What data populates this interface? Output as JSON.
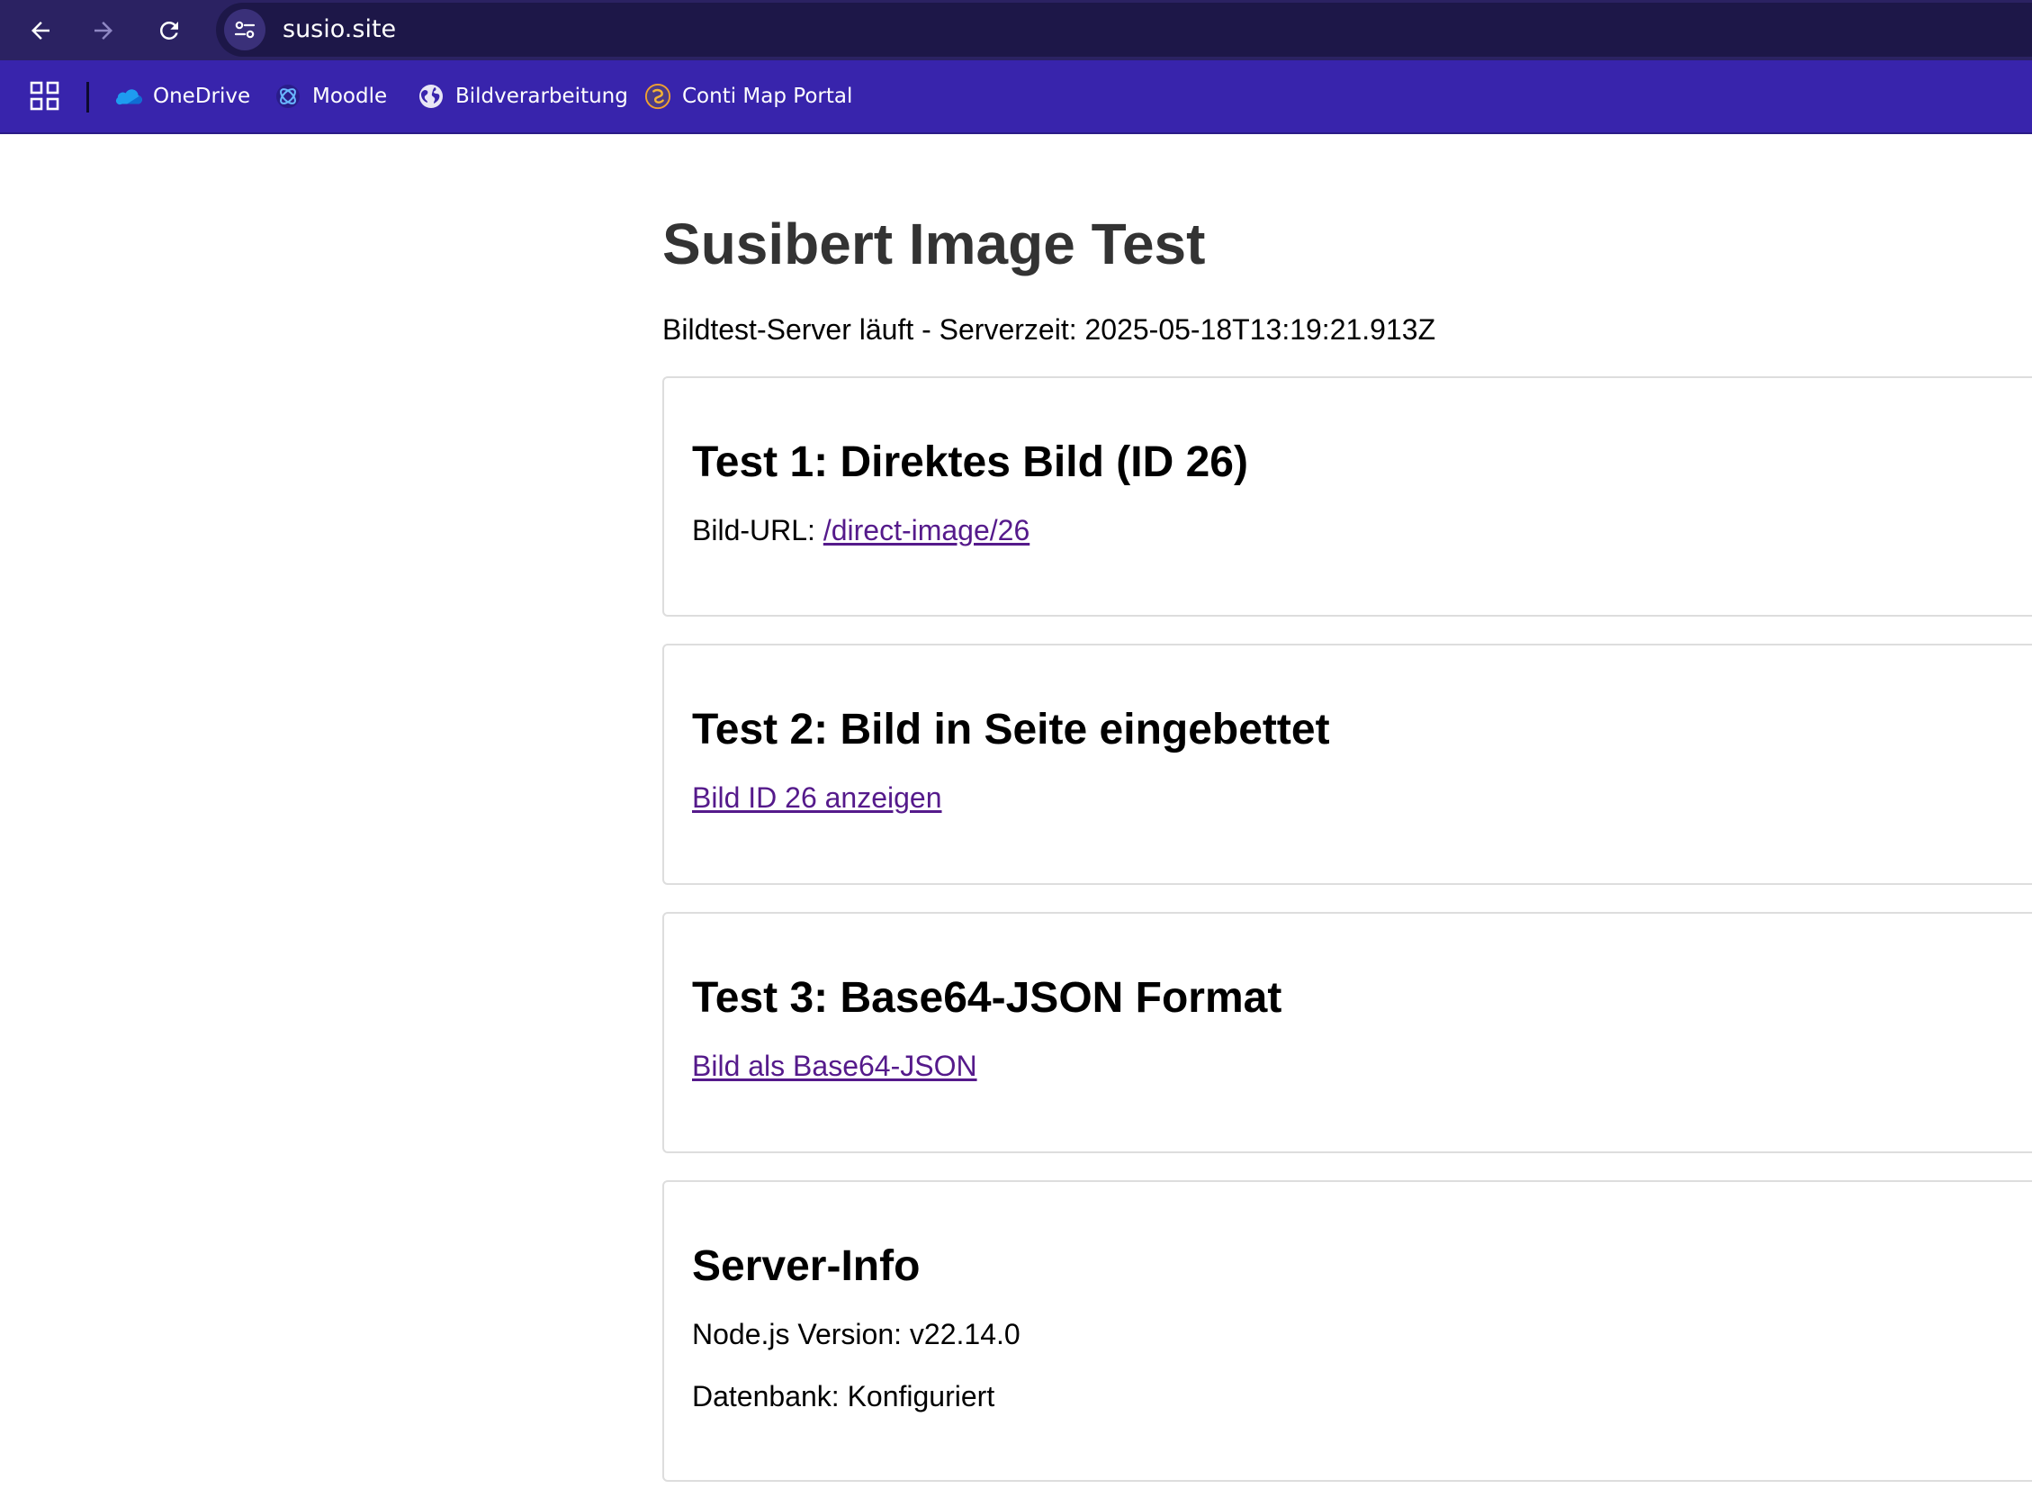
{
  "browser": {
    "url": "susio.site",
    "bookmarks": [
      {
        "label": "OneDrive",
        "icon": "onedrive-icon"
      },
      {
        "label": "Moodle",
        "icon": "moodle-icon"
      },
      {
        "label": "Bildverarbeitung",
        "icon": "globe-icon"
      },
      {
        "label": "Conti Map Portal",
        "icon": "conti-icon"
      }
    ],
    "colors": {
      "toolbar": "#2b2262",
      "bookmarks_bar": "#3824ac",
      "omnibox": "#1d1748"
    }
  },
  "page": {
    "title": "Susibert Image Test",
    "status": "Bildtest-Server läuft - Serverzeit: 2025-05-18T13:19:21.913Z",
    "cards": [
      {
        "title": "Test 1: Direktes Bild (ID 26)",
        "label": "Bild-URL: ",
        "link": "/direct-image/26"
      },
      {
        "title": "Test 2: Bild in Seite eingebettet",
        "link": "Bild ID 26 anzeigen"
      },
      {
        "title": "Test 3: Base64-JSON Format",
        "link": "Bild als Base64-JSON"
      },
      {
        "title": "Server-Info",
        "lines": [
          "Node.js Version: v22.14.0",
          "Datenbank: Konfiguriert"
        ]
      }
    ],
    "colors": {
      "title": "#333333",
      "link": "#551a8b",
      "card_border": "#dddddd"
    }
  }
}
